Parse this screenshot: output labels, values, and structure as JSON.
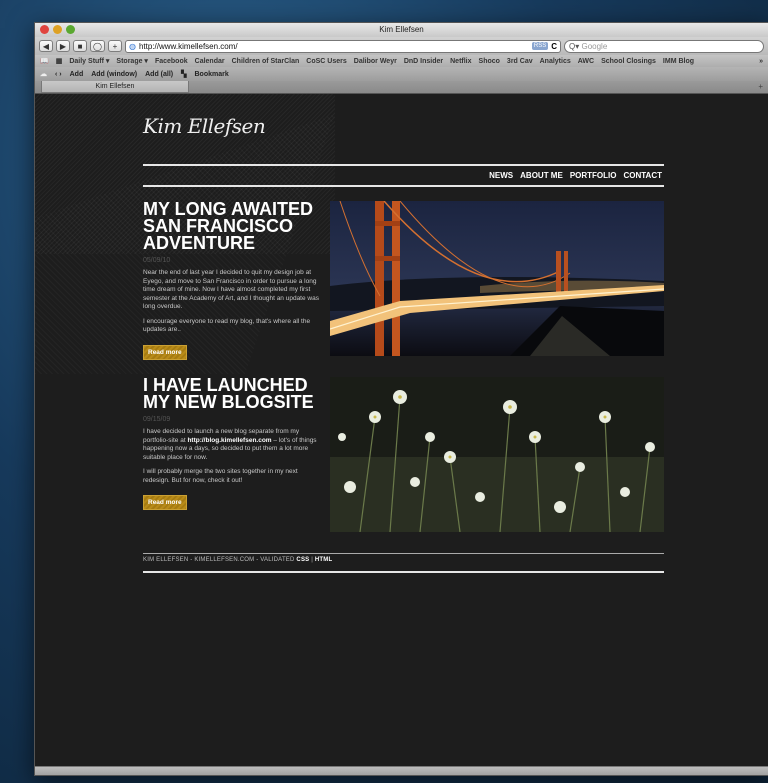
{
  "window": {
    "title": "Kim Ellefsen"
  },
  "toolbar": {
    "back": "◀",
    "forward": "▶",
    "add": "+",
    "url": "http://www.kimellefsen.com/",
    "rss": "RSS",
    "reload": "C",
    "search_placeholder": "Google"
  },
  "bookmarks": [
    "Daily Stuff ▾",
    "Storage ▾",
    "Facebook",
    "Calendar",
    "Children of StarClan",
    "CoSC Users",
    "Dalibor Weyr",
    "DnD Insider",
    "Netflix",
    "Shoco",
    "3rd Cav",
    "Analytics",
    "AWC",
    "School Closings",
    "IMM Blog"
  ],
  "bookmarks_overflow": "»",
  "extbar": {
    "items": [
      "Add",
      "Add (window)",
      "Add (all)",
      "Bookmark"
    ]
  },
  "tab": {
    "label": "Kim Ellefsen",
    "newtab": "+"
  },
  "site": {
    "logo": "Kim Ellefsen",
    "nav": [
      "NEWS",
      "ABOUT ME",
      "PORTFOLIO",
      "CONTACT"
    ],
    "posts": [
      {
        "title": "MY LONG AWAITED SAN FRANCISCO ADVENTURE",
        "date": "05/09/10",
        "p1": "Near the end of last year I decided to quit my design job at Eyego, and move to San Francisco in order to pursue a long time dream of mine. Now I have almost completed my first semester at the Academy of Art, and I thought an update was long overdue.",
        "p2": "I encourage everyone to read my blog, that's where all the updates are..",
        "button": "Read more"
      },
      {
        "title": "I HAVE LAUNCHED MY NEW BLOGSITE",
        "date": "09/15/09",
        "p1_a": "I have decided to launch a new blog separate from my portfolio-site at ",
        "p1_link": "http://blog.kimellefsen.com",
        "p1_b": " – lot's of things happening now a days, so decided to put them a lot more suitable place for now.",
        "p2": "I will probably merge the two sites together in my next redesign. But for now, check it out!",
        "button": "Read more"
      }
    ],
    "footer": {
      "text": "KIM ELLEFSEN - KIMELLEFSEN.COM - VALIDATED ",
      "css": "CSS",
      "sep": " | ",
      "html": "HTML"
    }
  }
}
